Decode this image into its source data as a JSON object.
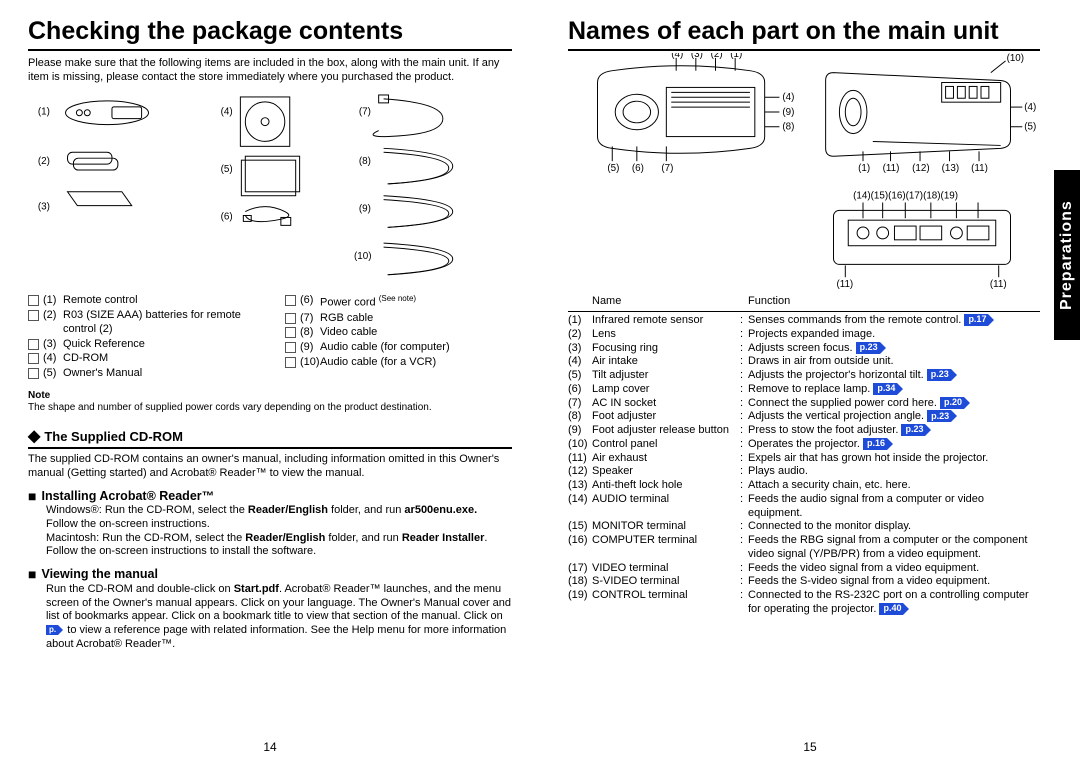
{
  "left": {
    "title": "Checking the package contents",
    "intro": "Please make sure that the following items are included in the box, along with the main unit. If any item is missing, please contact the store immediately where you purchased the product.",
    "checklist_a": [
      {
        "n": "(1)",
        "t": "Remote control"
      },
      {
        "n": "(2)",
        "t": "R03 (SIZE AAA) batteries for remote control (2)"
      },
      {
        "n": "(3)",
        "t": "Quick Reference"
      },
      {
        "n": "(4)",
        "t": "CD-ROM"
      },
      {
        "n": "(5)",
        "t": "Owner's Manual"
      }
    ],
    "checklist_b": [
      {
        "n": "(6)",
        "t": "Power cord",
        "sup": "(See note)"
      },
      {
        "n": "(7)",
        "t": "RGB cable"
      },
      {
        "n": "(8)",
        "t": "Video cable"
      },
      {
        "n": "(9)",
        "t": "Audio cable (for computer)"
      },
      {
        "n": "(10)",
        "t": "Audio cable (for a VCR)"
      }
    ],
    "note_hd": "Note",
    "note_text": "The shape and number of supplied power cords vary depending on the product destination.",
    "cd_hd": "The Supplied CD-ROM",
    "cd_body": "The supplied CD-ROM contains an owner's manual, including information omitted in this Owner's manual (Getting started) and Acrobat® Reader™ to view the manual.",
    "install_hd": "Installing Acrobat® Reader™",
    "install_l1a": "Windows®: Run the CD-ROM, select the ",
    "install_l1b": "Reader/English",
    "install_l1c": " folder, and run ",
    "install_l1d": "ar500enu.exe.",
    "install_l2": "Follow the on-screen instructions.",
    "install_l3a": "Macintosh: Run the CD-ROM, select the ",
    "install_l3b": "Reader/English",
    "install_l3c": " folder, and run ",
    "install_l3d": "Reader Installer",
    "install_l3e": ". Follow the on-screen instructions to install the software.",
    "view_hd": "Viewing the manual",
    "view_a": "Run the CD-ROM and double-click on ",
    "view_b": "Start.pdf",
    "view_c": ". Acrobat® Reader™ launches, and the menu screen of the Owner's manual appears. Click on your language. The Owner's Manual cover and list of bookmarks appear. Click on a bookmark title to view that section of the manual. Click on ",
    "view_pref": "p.",
    "view_d": " to view a reference page with related information. See the Help menu for more information about Acrobat® Reader™.",
    "pagenum": "14"
  },
  "right": {
    "title": "Names of each part on the main unit",
    "col_name": "Name",
    "col_func": "Function",
    "rows": [
      {
        "n": "(1)",
        "name": "Infrared remote sensor",
        "func": "Senses commands from the remote control.",
        "pref": "p.17"
      },
      {
        "n": "(2)",
        "name": "Lens",
        "func": "Projects expanded image."
      },
      {
        "n": "(3)",
        "name": "Focusing ring",
        "func": "Adjusts screen focus.",
        "pref": "p.23"
      },
      {
        "n": "(4)",
        "name": "Air intake",
        "func": "Draws in air from outside unit."
      },
      {
        "n": "(5)",
        "name": "Tilt adjuster",
        "func": "Adjusts the projector's horizontal tilt.",
        "pref": "p.23"
      },
      {
        "n": "(6)",
        "name": "Lamp cover",
        "func": "Remove to replace lamp.",
        "pref": "p.34"
      },
      {
        "n": "(7)",
        "name": "AC IN socket",
        "func": "Connect the supplied power cord here.",
        "pref": "p.20"
      },
      {
        "n": "(8)",
        "name": "Foot adjuster",
        "func": "Adjusts the vertical projection angle.",
        "pref": "p.23"
      },
      {
        "n": "(9)",
        "name": "Foot adjuster release button",
        "func": "Press to stow the foot adjuster.",
        "pref": "p.23"
      },
      {
        "n": "(10)",
        "name": "Control panel",
        "func": "Operates the projector.",
        "pref": "p.16"
      },
      {
        "n": "(11)",
        "name": "Air exhaust",
        "func": "Expels air that has grown hot inside the projector."
      },
      {
        "n": "(12)",
        "name": "Speaker",
        "func": "Plays audio."
      },
      {
        "n": "(13)",
        "name": "Anti-theft lock hole",
        "func": "Attach a security chain, etc. here."
      },
      {
        "n": "(14)",
        "name": "AUDIO terminal",
        "func": "Feeds the audio signal from a computer or video equipment."
      },
      {
        "n": "(15)",
        "name": "MONITOR terminal",
        "func": "Connected to the monitor display."
      },
      {
        "n": "(16)",
        "name": "COMPUTER terminal",
        "func": "Feeds the RBG signal from a computer or the component video signal (Y/PB/PR) from a video equipment."
      },
      {
        "n": "(17)",
        "name": "VIDEO terminal",
        "func": "Feeds the video signal from a video equipment."
      },
      {
        "n": "(18)",
        "name": "S-VIDEO terminal",
        "func": "Feeds the S-video signal from a video equipment."
      },
      {
        "n": "(19)",
        "name": "CONTROL terminal",
        "func": "Connected to the RS-232C port on a controlling computer for operating the projector.",
        "pref": "p.40"
      }
    ],
    "sidetab": "Preparations",
    "pagenum": "15",
    "diag_a": {
      "top": [
        "(4)",
        "(3)",
        "(2)",
        "(1)"
      ],
      "right": [
        "(4)",
        "(9)",
        "(8)"
      ],
      "bottom": [
        "(5)",
        "(6)",
        "(7)"
      ]
    },
    "diag_b": {
      "top_right": "(10)",
      "right": [
        "(4)",
        "(5)"
      ],
      "bottom": [
        "(1)",
        "(11)",
        "(12)",
        "(13)",
        "(11)"
      ]
    },
    "diag_c": {
      "top": "(14)(15)(16)(17)(18)(19)",
      "bottom": [
        "(11)",
        "(11)"
      ]
    }
  }
}
